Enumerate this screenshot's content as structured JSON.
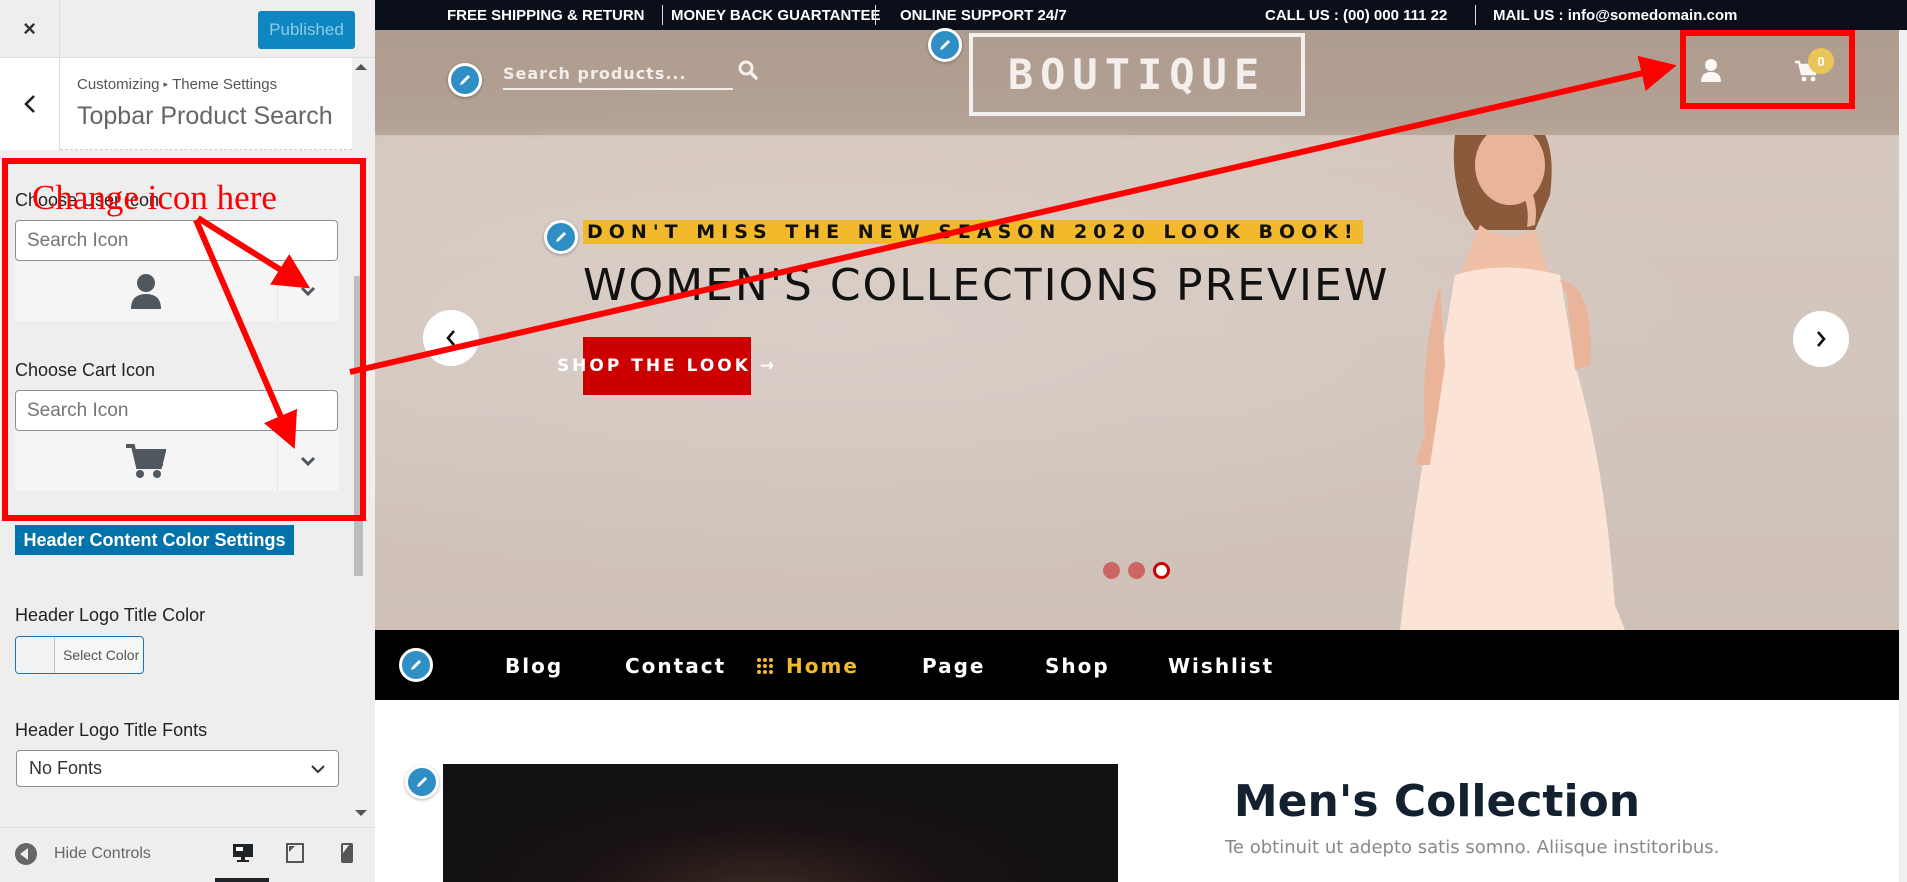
{
  "customizer": {
    "close_label": "×",
    "publish_label": "Published",
    "back_label": "<",
    "breadcrumb": {
      "root": "Customizing",
      "separator": "▸",
      "parent": "Theme Settings"
    },
    "section_title": "Topbar Product Search",
    "controls": {
      "user_icon": {
        "label": "Choose User Icon",
        "search_placeholder": "Search Icon",
        "selected_icon": "user-icon"
      },
      "cart_icon": {
        "label": "Choose Cart Icon",
        "search_placeholder": "Search Icon",
        "selected_icon": "shopping-cart-icon"
      },
      "color_section_label": "Header Content Color Settings",
      "logo_color": {
        "label": "Header Logo Title Color",
        "button_label": "Select Color"
      },
      "logo_fonts": {
        "label": "Header Logo Title Fonts",
        "selected": "No Fonts"
      }
    },
    "footer": {
      "hide_controls_label": "Hide Controls",
      "devices": [
        {
          "name": "desktop",
          "active": true
        },
        {
          "name": "tablet",
          "active": false
        },
        {
          "name": "mobile",
          "active": false
        }
      ]
    }
  },
  "site": {
    "topbar": {
      "items": [
        "FREE SHIPPING & RETURN",
        "MONEY BACK GUARTANTEE",
        "ONLINE SUPPORT 24/7"
      ],
      "call": "CALL US : (00) 000 111 22",
      "mail": "MAIL US : info@somedomain.com"
    },
    "header": {
      "search_placeholder": "Search products...",
      "logo": "BOUTIQUE",
      "cart_count": "0"
    },
    "hero": {
      "tagline": "DON'T MISS THE NEW SEASON 2020 LOOK BOOK!",
      "title": "WOMEN'S COLLECTIONS PREVIEW",
      "cta": "SHOP THE LOOK",
      "cta_icon": "→",
      "slides_total": 3,
      "active_slide": 3
    },
    "nav": {
      "items": [
        "Blog",
        "Contact",
        "Home",
        "Page",
        "Shop",
        "Wishlist"
      ],
      "active": "Home"
    },
    "section": {
      "title": "Men's Collection",
      "subtitle": "Te obtinuit ut adepto satis somno. Aliisque institoribus."
    }
  },
  "annotation": {
    "text": "Change icon here",
    "color": "#ff0000"
  },
  "colors": {
    "wp_blue": "#0073aa",
    "publish_blue": "#0e86c1",
    "topbar_bg": "#0b0f19",
    "accent_yellow": "#f3b92c",
    "cta_red": "#cc0000",
    "edit_pencil": "#2f8fc5"
  }
}
